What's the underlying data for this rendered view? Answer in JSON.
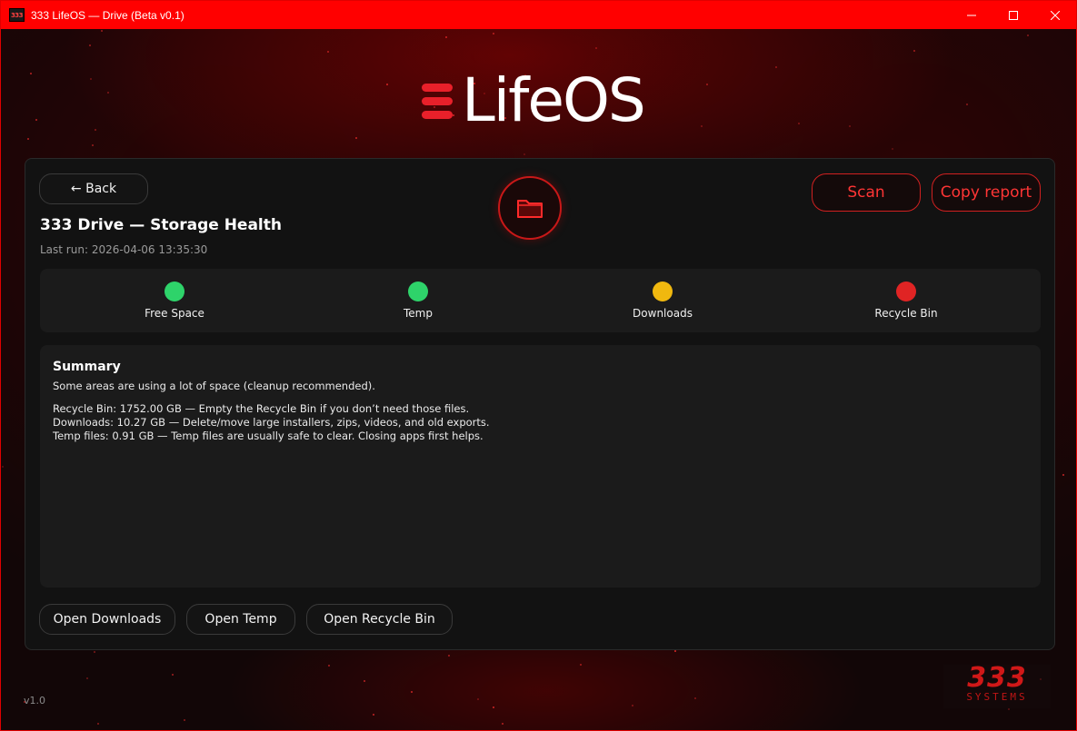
{
  "window": {
    "title": "333 LifeOS — Drive (Beta v0.1)",
    "icon_text": "333",
    "controls": [
      "minimize-icon",
      "maximize-icon",
      "close-icon"
    ]
  },
  "logo": {
    "text": "LifeOS",
    "accent": "#e8202a"
  },
  "header": {
    "back_label": "← Back",
    "title": "333 Drive — Storage Health",
    "last_run": "Last run: 2026-04-06 13:35:30",
    "center_icon": "folder-icon",
    "scan_label": "Scan",
    "copy_report_label": "Copy report"
  },
  "status": {
    "items": [
      {
        "label": "Free Space",
        "color": "#2ed36a"
      },
      {
        "label": "Temp",
        "color": "#2ed36a"
      },
      {
        "label": "Downloads",
        "color": "#f0b80f"
      },
      {
        "label": "Recycle Bin",
        "color": "#e02424"
      }
    ]
  },
  "summary": {
    "title": "Summary",
    "intro": "Some areas are using a lot of space (cleanup recommended).",
    "lines": [
      "Recycle Bin: 1752.00 GB — Empty the Recycle Bin if you don’t need those files.",
      "Downloads: 10.27 GB — Delete/move large installers, zips, videos, and old exports.",
      "Temp files: 0.91 GB — Temp files are usually safe to clear. Closing apps first helps."
    ]
  },
  "actions": {
    "open_downloads": "Open Downloads",
    "open_temp": "Open Temp",
    "open_recycle_bin": "Open Recycle Bin"
  },
  "footer": {
    "version": "v1.0",
    "brand_number": "333",
    "brand_sub": "SYSTEMS"
  }
}
